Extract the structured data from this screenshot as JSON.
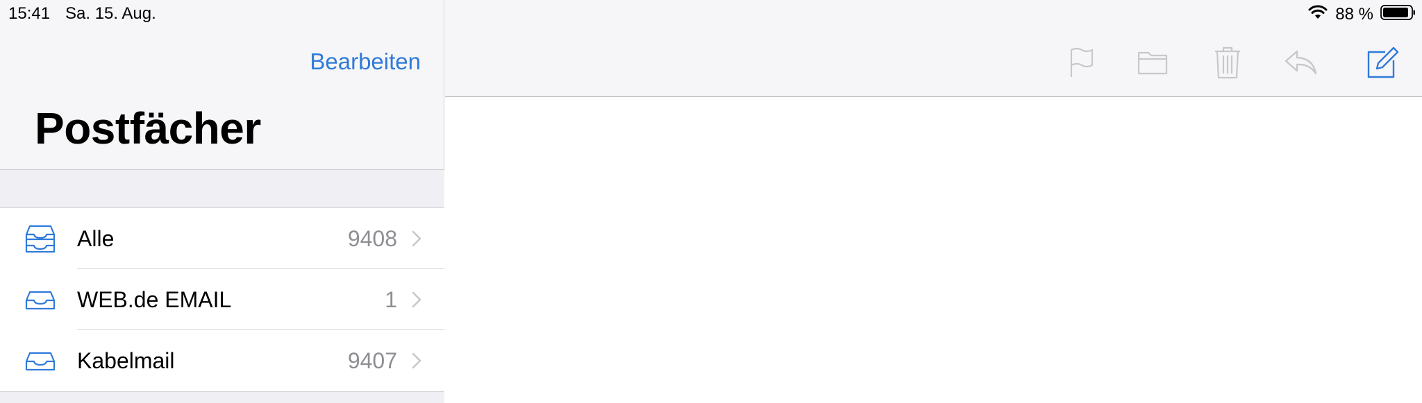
{
  "status": {
    "time": "15:41",
    "date": "Sa. 15. Aug.",
    "battery": "88 %"
  },
  "sidebar": {
    "edit_label": "Bearbeiten",
    "title": "Postfächer",
    "mailboxes": [
      {
        "label": "Alle",
        "count": "9408",
        "icon": "all-inboxes-icon"
      },
      {
        "label": "WEB.de EMAIL",
        "count": "1",
        "icon": "inbox-icon"
      },
      {
        "label": "Kabelmail",
        "count": "9407",
        "icon": "inbox-icon"
      }
    ]
  },
  "toolbar": {
    "icons": [
      "flag-icon",
      "folder-icon",
      "trash-icon",
      "reply-icon",
      "compose-icon"
    ]
  },
  "colors": {
    "accent": "#2f7ad9",
    "disabled_icon": "#c7c7cc",
    "sidebar_bg": "#f6f6f8",
    "group_bg": "#efeff4"
  }
}
